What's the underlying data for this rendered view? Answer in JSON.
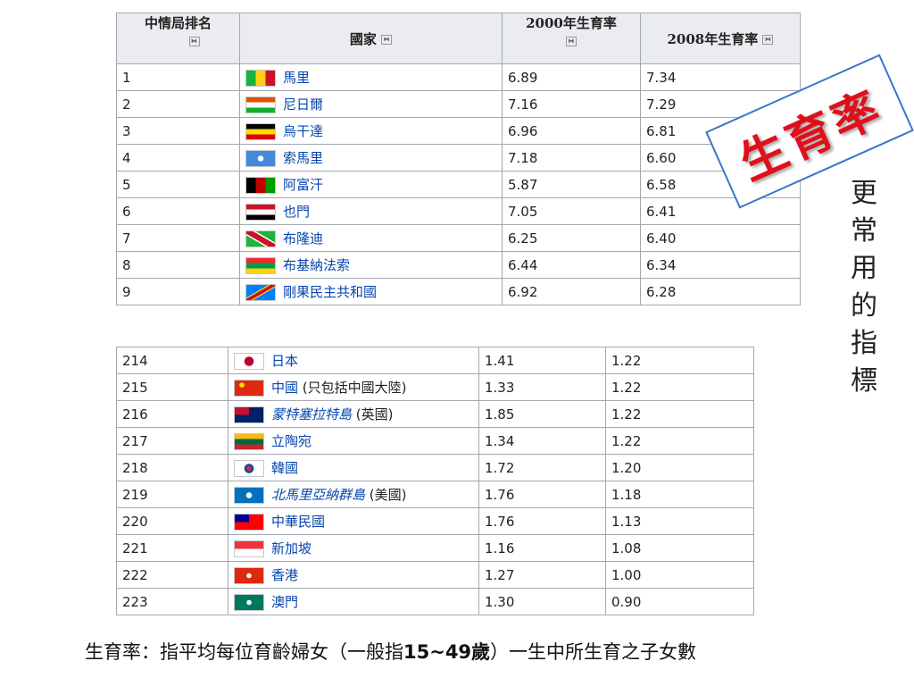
{
  "headers": {
    "rank": "中情局排名",
    "country": "國家",
    "rate2000": "2000年生育率",
    "rate2008": "2008年生育率",
    "sort_icon": "⧓"
  },
  "top_rows": [
    {
      "rank": "1",
      "country": "馬里",
      "rate2000": "6.89",
      "rate2008": "7.34",
      "flag": "mali-flag",
      "colors": [
        "#14b53a",
        "#fcd116",
        "#ce1126"
      ]
    },
    {
      "rank": "2",
      "country": "尼日爾",
      "rate2000": "7.16",
      "rate2008": "7.29",
      "flag": "niger-flag",
      "colors": [
        "#e05206",
        "#ffffff",
        "#0db02b"
      ]
    },
    {
      "rank": "3",
      "country": "烏干達",
      "rate2000": "6.96",
      "rate2008": "6.81",
      "flag": "uganda-flag",
      "colors": [
        "#000000",
        "#fcdc04",
        "#d90000"
      ]
    },
    {
      "rank": "4",
      "country": "索馬里",
      "rate2000": "7.18",
      "rate2008": "6.60",
      "flag": "somalia-flag",
      "colors": [
        "#4189dd",
        "#ffffff"
      ]
    },
    {
      "rank": "5",
      "country": "阿富汗",
      "rate2000": "5.87",
      "rate2008": "6.58",
      "flag": "afghanistan-flag",
      "colors": [
        "#000000",
        "#be0000",
        "#009900"
      ]
    },
    {
      "rank": "6",
      "country": "也門",
      "rate2000": "7.05",
      "rate2008": "6.41",
      "flag": "yemen-flag",
      "colors": [
        "#ce1126",
        "#ffffff",
        "#000000"
      ]
    },
    {
      "rank": "7",
      "country": "布隆迪",
      "rate2000": "6.25",
      "rate2008": "6.40",
      "flag": "burundi-flag",
      "colors": [
        "#ce1126",
        "#1eb53a",
        "#ffffff"
      ]
    },
    {
      "rank": "8",
      "country": "布基納法索",
      "rate2000": "6.44",
      "rate2008": "6.34",
      "flag": "burkina-faso-flag",
      "colors": [
        "#ef2b2d",
        "#009e49",
        "#fcd116"
      ]
    },
    {
      "rank": "9",
      "country": "剛果民主共和國",
      "rate2000": "6.92",
      "rate2008": "6.28",
      "flag": "dr-congo-flag",
      "colors": [
        "#007fff",
        "#ce1021",
        "#f7d618"
      ]
    }
  ],
  "bottom_rows": [
    {
      "rank": "214",
      "country": "日本",
      "suffix": "",
      "rate2000": "1.41",
      "rate2008": "1.22",
      "flag": "japan-flag",
      "style": "link",
      "colors": [
        "#ffffff",
        "#bc002d"
      ]
    },
    {
      "rank": "215",
      "country": "中國",
      "suffix": " (只包括中國大陸)",
      "rate2000": "1.33",
      "rate2008": "1.22",
      "flag": "china-flag",
      "style": "link",
      "colors": [
        "#de2910",
        "#ffde00"
      ]
    },
    {
      "rank": "216",
      "country": "蒙特塞拉特島",
      "suffix": " (英國)",
      "rate2000": "1.85",
      "rate2008": "1.22",
      "flag": "montserrat-flag",
      "style": "italic",
      "colors": [
        "#012169",
        "#c8102e",
        "#ffffff"
      ]
    },
    {
      "rank": "217",
      "country": "立陶宛",
      "suffix": "",
      "rate2000": "1.34",
      "rate2008": "1.22",
      "flag": "lithuania-flag",
      "style": "link",
      "colors": [
        "#fdb913",
        "#006a44",
        "#c1272d"
      ]
    },
    {
      "rank": "218",
      "country": "韓國",
      "suffix": "",
      "rate2000": "1.72",
      "rate2008": "1.20",
      "flag": "south-korea-flag",
      "style": "link",
      "colors": [
        "#ffffff",
        "#cd2e3a",
        "#0047a0"
      ]
    },
    {
      "rank": "219",
      "country": "北馬里亞納群島",
      "suffix": " (美國)",
      "rate2000": "1.76",
      "rate2008": "1.18",
      "flag": "northern-mariana-flag",
      "style": "italic",
      "colors": [
        "#0071bc",
        "#ffffff"
      ]
    },
    {
      "rank": "220",
      "country": "中華民國",
      "suffix": "",
      "rate2000": "1.76",
      "rate2008": "1.13",
      "flag": "taiwan-flag",
      "style": "link",
      "colors": [
        "#fe0000",
        "#000095",
        "#ffffff"
      ]
    },
    {
      "rank": "221",
      "country": "新加坡",
      "suffix": "",
      "rate2000": "1.16",
      "rate2008": "1.08",
      "flag": "singapore-flag",
      "style": "link",
      "colors": [
        "#ef3340",
        "#ffffff"
      ]
    },
    {
      "rank": "222",
      "country": "香港",
      "suffix": "",
      "rate2000": "1.27",
      "rate2008": "1.00",
      "flag": "hong-kong-flag",
      "style": "link",
      "colors": [
        "#de2910",
        "#ffffff"
      ]
    },
    {
      "rank": "223",
      "country": "澳門",
      "suffix": "",
      "rate2000": "1.30",
      "rate2008": "0.90",
      "flag": "macau-flag",
      "style": "link",
      "colors": [
        "#00785e",
        "#ffffff"
      ]
    }
  ],
  "stamp": {
    "text": "生育率",
    "color": "#e0101a",
    "border": "#3a76c8"
  },
  "side_note": "更常用的指標",
  "footnote": {
    "pre": "生育率：指平均每位育齡婦女（一般指",
    "bold": "15~49歲",
    "post": "）一生中所生育之子女數"
  }
}
